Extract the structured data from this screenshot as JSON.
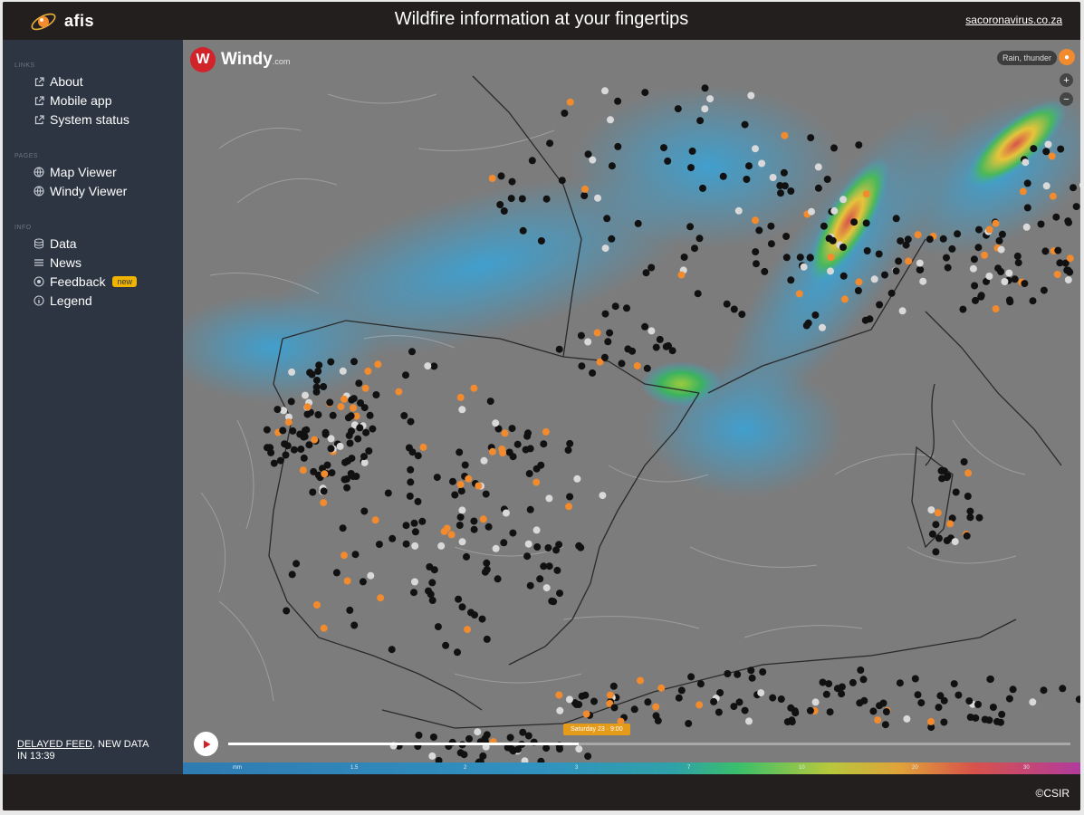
{
  "header": {
    "logo_text": "afis",
    "title": "Wildfire information at your fingertips",
    "site_link": "sacoronavirus.co.za"
  },
  "sidebar": {
    "sections": [
      {
        "heading": "LINKS",
        "items": [
          {
            "label": "About",
            "icon": "external-link-icon"
          },
          {
            "label": "Mobile app",
            "icon": "external-link-icon"
          },
          {
            "label": "System status",
            "icon": "external-link-icon"
          }
        ]
      },
      {
        "heading": "PAGES",
        "items": [
          {
            "label": "Map Viewer",
            "icon": "globe-icon"
          },
          {
            "label": "Windy Viewer",
            "icon": "globe-icon"
          }
        ]
      },
      {
        "heading": "INFO",
        "items": [
          {
            "label": "Data",
            "icon": "database-icon"
          },
          {
            "label": "News",
            "icon": "list-icon"
          },
          {
            "label": "Feedback",
            "icon": "feedback-icon",
            "badge": "new"
          },
          {
            "label": "Legend",
            "icon": "info-icon"
          }
        ]
      }
    ],
    "feed_status_link": "DELAYED FEED",
    "feed_status_rest": ", NEW DATA IN 13:39"
  },
  "map": {
    "windy_logo": "Windy",
    "windy_suffix": ".com",
    "layer_label": "Rain, thunder",
    "zoom_in": "+",
    "zoom_out": "−",
    "time_label": "Saturday 23 · 9:00",
    "timeline_progress": 0.416,
    "legend_ticks": [
      "mm",
      "1.5",
      "2",
      "3",
      "7",
      "10",
      "20",
      "30"
    ],
    "colors": {
      "accent": "#e59b1a",
      "fire": "#f28a2e",
      "brand": "#d2232a"
    }
  },
  "footer": {
    "copyright": "©CSIR"
  }
}
